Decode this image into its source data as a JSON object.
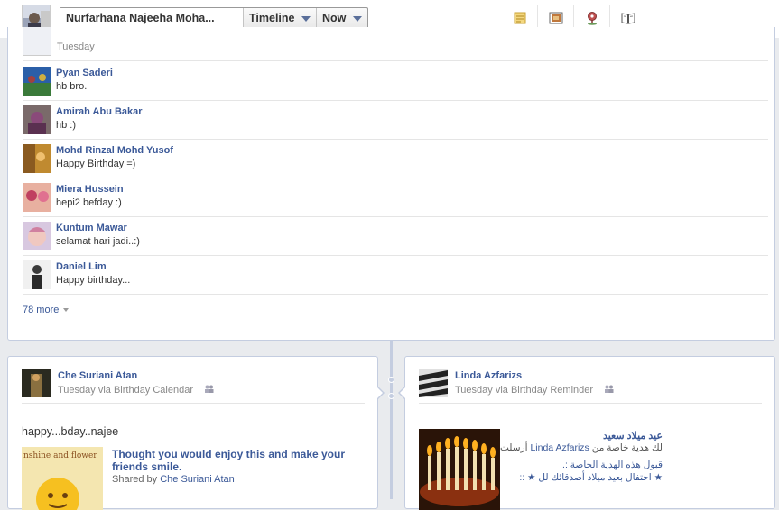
{
  "header": {
    "profile_name": "Nurfarhana Najeeha Moha...",
    "timeline_label": "Timeline",
    "now_label": "Now",
    "icons": [
      "notes-icon",
      "photo-album-icon",
      "place-icon",
      "book-icon"
    ]
  },
  "day_group": {
    "label": "Tuesday"
  },
  "comments": [
    {
      "name": "Pyan Saderi",
      "text": "hb bro."
    },
    {
      "name": "Amirah Abu Bakar",
      "text": "hb :)"
    },
    {
      "name": "Mohd Rinzal Mohd Yusof",
      "text": "Happy Birthday =)"
    },
    {
      "name": "Miera Hussein",
      "text": "hepi2 befday :)"
    },
    {
      "name": "Kuntum Mawar",
      "text": "selamat hari jadi..:)"
    },
    {
      "name": "Daniel Lim",
      "text": "Happy birthday..."
    }
  ],
  "more_link": "78 more",
  "left_story": {
    "author": "Che Suriani Atan",
    "meta": "Tuesday via Birthday Calendar",
    "message": "happy...bday..najee",
    "share_title": "Thought you would enjoy this and make your friends smile.",
    "share_by_prefix": "Shared by",
    "share_by_name": "Che Suriani Atan"
  },
  "right_story": {
    "author": "Linda Azfarizs",
    "meta": "Tuesday via Birthday Reminder",
    "ar_title": "عيد ميلاد سعيد",
    "ar_line2_pre": "لك هدية خاصة من",
    "ar_line2_name": "Linda Azfarizs",
    "ar_line2_post": "أرسلت",
    "ar_line3": "قبول هذه الهدية الخاصة :.",
    "ar_line4": "★ احتفال بعيد ميلاد أصدقائك لل ★ ::"
  },
  "colors": {
    "link": "#3b5998",
    "border": "#c4cde0",
    "background": "#e9ebee"
  }
}
